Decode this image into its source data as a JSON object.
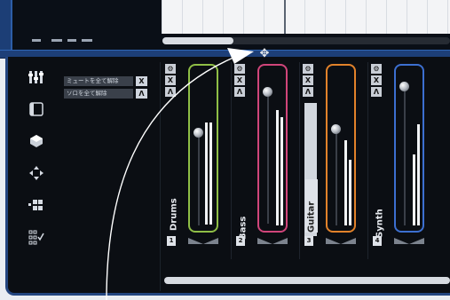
{
  "reset_panel": {
    "mute_reset_label": "ミュートを全て解除",
    "solo_reset_label": "ソロを全て解除",
    "mute_reset_icon": "X",
    "solo_reset_icon": "Λ"
  },
  "channels": [
    {
      "name": "Drums",
      "number": "1",
      "color": "#8fbe46",
      "selected": false
    },
    {
      "name": "Bass",
      "number": "2",
      "color": "#d0457a",
      "selected": false
    },
    {
      "name": "Guitar",
      "number": "3",
      "color": "#e2822a",
      "selected": true
    },
    {
      "name": "Synth",
      "number": "4",
      "color": "#3c6fd0",
      "selected": false
    }
  ],
  "channel_button_glyphs": {
    "edit": "⚙",
    "mute": "X",
    "solo": "Λ"
  },
  "tools": [
    "mixer-icon",
    "inspector-icon",
    "instrument-icon",
    "move-icon",
    "grid-icon",
    "checklist-icon"
  ],
  "colors": {
    "frame_blue": "#1d3f78",
    "panel_dark": "#0b0e13"
  }
}
